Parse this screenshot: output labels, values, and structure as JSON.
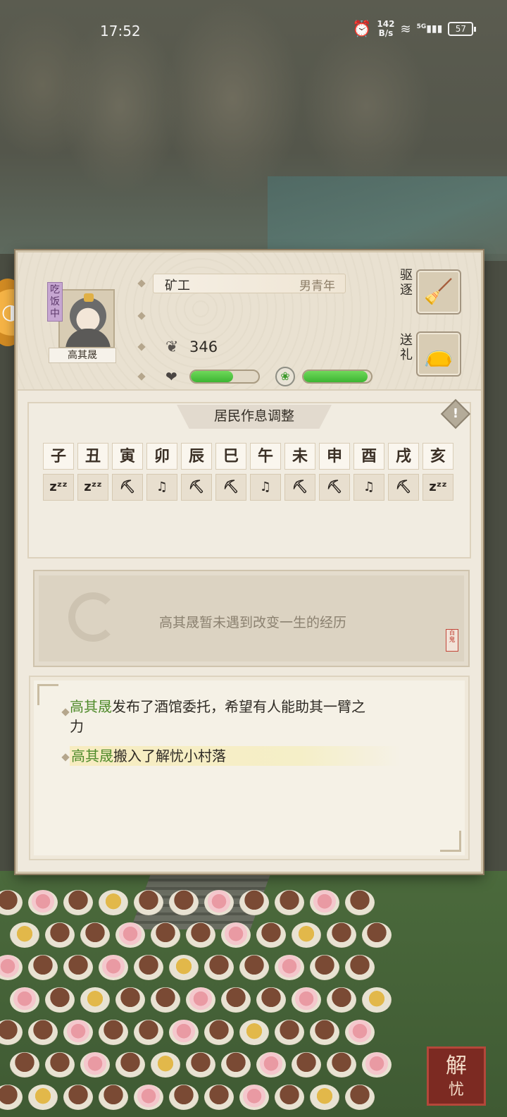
{
  "status_bar": {
    "time": "17:52",
    "net_speed_value": "142",
    "net_speed_unit": "B/s",
    "signal_label": "5G",
    "battery": "57"
  },
  "resident": {
    "status_badge": "吃饭中",
    "name": "高其晟",
    "job": "矿工",
    "gender_age": "男青年",
    "money": "346",
    "health_fraction": 0.62,
    "mood_fraction": 0.95
  },
  "actions": {
    "expel_label": "驱逐",
    "gift_label": "送礼"
  },
  "schedule": {
    "title": "居民作息调整",
    "info_icon": "!",
    "hours": [
      "子",
      "丑",
      "寅",
      "卯",
      "辰",
      "巳",
      "午",
      "未",
      "申",
      "酉",
      "戌",
      "亥"
    ],
    "activities": [
      "sleep",
      "sleep",
      "work",
      "leisure",
      "work",
      "work",
      "leisure",
      "work",
      "work",
      "leisure",
      "work",
      "sleep"
    ]
  },
  "life": {
    "text": "高其晟暂未遇到改变一生的经历",
    "seal_text": "百鬼"
  },
  "log": [
    {
      "name": "高其晟",
      "text": "发布了酒馆委托，希望有人能助其一臂之",
      "text2": "力"
    },
    {
      "name": "高其晟",
      "text": "搬入了解忧小村落"
    }
  ],
  "corner_seal": {
    "line1": "解",
    "line2": "忧"
  },
  "colors": {
    "bar_green": "#3cb532",
    "log_name": "#4e8a2a",
    "panel_bg": "#efe9dd"
  }
}
